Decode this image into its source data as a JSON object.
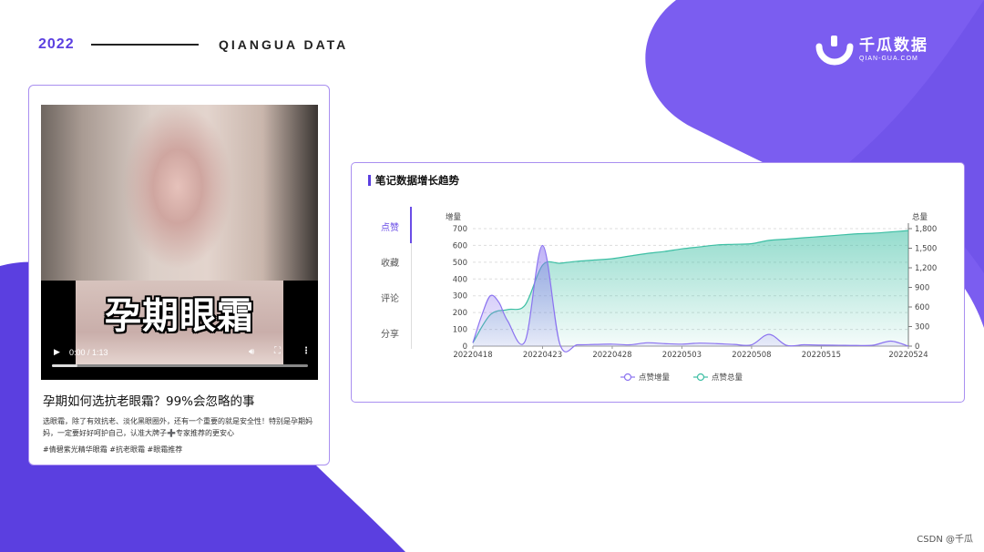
{
  "header": {
    "year": "2022",
    "brand": "QIANGUA DATA"
  },
  "logo": {
    "name_cn": "千瓜数据",
    "name_en": "QIAN-GUA.COM"
  },
  "colors": {
    "accent": "#5b3fe0",
    "purple": "#8b73f0",
    "teal": "#3dbfa4",
    "card_border": "#a98ff0"
  },
  "post": {
    "video_caption": "孕期眼霜",
    "video_time": "0:00 / 1:13",
    "video_progress": 0.1,
    "title": "孕期如何选抗老眼霜？99%会忽略的事",
    "description": "选眼霜，除了有效抗老、淡化黑眼圈外，还有一个重要的就是安全性！特别是孕期妈妈，一定要好好呵护自己，认准大牌子➕专家推荐的更安心",
    "tags": "#倩碧紫光精华眼霜 #抗老眼霜 #眼霜推荐"
  },
  "panel": {
    "title": "笔记数据增长趋势",
    "tabs": [
      {
        "label": "点赞",
        "active": true
      },
      {
        "label": "收藏",
        "active": false
      },
      {
        "label": "评论",
        "active": false
      },
      {
        "label": "分享",
        "active": false
      }
    ]
  },
  "chart_data": {
    "type": "area",
    "y_left_label": "增量",
    "y_right_label": "总量",
    "ylim_left": [
      0,
      700
    ],
    "ylim_right": [
      0,
      1800
    ],
    "yticks_left": [
      "0",
      "100",
      "200",
      "300",
      "400",
      "500",
      "600",
      "700"
    ],
    "yticks_right": [
      "0",
      "300",
      "600",
      "900",
      "1,200",
      "1,500",
      "1,800"
    ],
    "xtick_labels": [
      "20220418",
      "20220423",
      "20220428",
      "20220503",
      "20220508",
      "20220515",
      "20220524"
    ],
    "grid": true,
    "legend_position": "bottom",
    "series": [
      {
        "name": "点赞增量",
        "axis": "left",
        "color": "#8b73f0",
        "values": [
          [
            0,
            20
          ],
          [
            0.5,
            180
          ],
          [
            1,
            300
          ],
          [
            1.5,
            260
          ],
          [
            2,
            150
          ],
          [
            3,
            30
          ],
          [
            4,
            600
          ],
          [
            5,
            10
          ],
          [
            6,
            8
          ],
          [
            7,
            10
          ],
          [
            8,
            12
          ],
          [
            9,
            8
          ],
          [
            10,
            20
          ],
          [
            11,
            15
          ],
          [
            12,
            12
          ],
          [
            13,
            18
          ],
          [
            14,
            15
          ],
          [
            15,
            10
          ],
          [
            16,
            8
          ],
          [
            17,
            70
          ],
          [
            18,
            5
          ],
          [
            19,
            8
          ],
          [
            20,
            6
          ],
          [
            21,
            5
          ],
          [
            22,
            4
          ],
          [
            23,
            6
          ],
          [
            24,
            30
          ],
          [
            25,
            0
          ]
        ]
      },
      {
        "name": "点赞总量",
        "axis": "right",
        "color": "#3dbfa4",
        "values": [
          [
            0,
            50
          ],
          [
            1,
            480
          ],
          [
            2,
            560
          ],
          [
            3,
            630
          ],
          [
            4,
            1240
          ],
          [
            5,
            1270
          ],
          [
            6,
            1300
          ],
          [
            7,
            1320
          ],
          [
            8,
            1340
          ],
          [
            9,
            1380
          ],
          [
            10,
            1420
          ],
          [
            11,
            1450
          ],
          [
            12,
            1490
          ],
          [
            13,
            1520
          ],
          [
            14,
            1550
          ],
          [
            15,
            1560
          ],
          [
            16,
            1570
          ],
          [
            17,
            1620
          ],
          [
            18,
            1640
          ],
          [
            19,
            1660
          ],
          [
            20,
            1680
          ],
          [
            21,
            1700
          ],
          [
            22,
            1720
          ],
          [
            23,
            1730
          ],
          [
            24,
            1750
          ],
          [
            25,
            1770
          ]
        ]
      }
    ]
  },
  "footer": {
    "note": "CSDN @千瓜"
  }
}
